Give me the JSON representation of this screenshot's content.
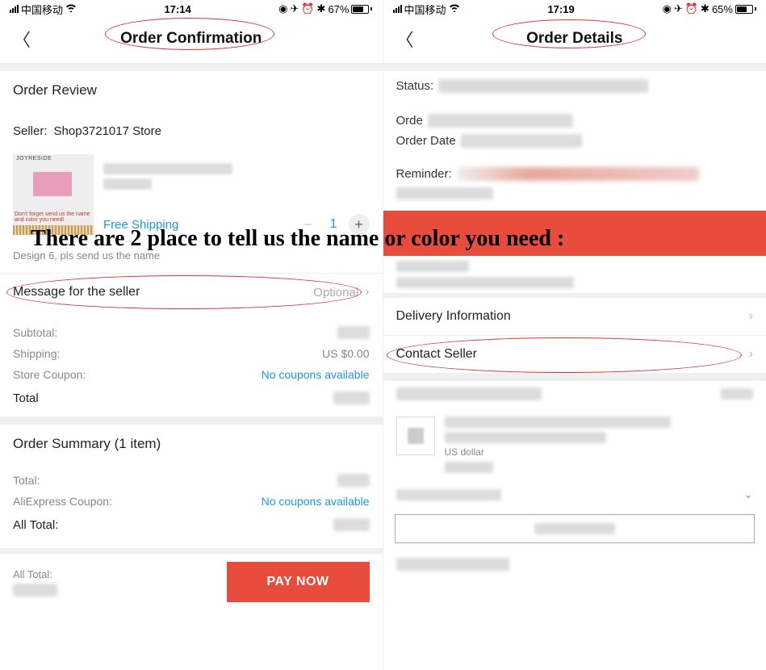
{
  "overlay_text": "There are 2 place to tell us the name or color you need :",
  "left": {
    "status": {
      "carrier": "中国移动",
      "time": "17:14",
      "battery_pct": "67%"
    },
    "nav_title": "Order Confirmation",
    "order_review_title": "Order Review",
    "seller_label": "Seller:",
    "seller_name": "Shop3721017 Store",
    "thumb_brand": "JOYRESIDE",
    "thumb_note": "Don't forget send us the name and color you need!",
    "shipping": "Free Shipping",
    "quantity": "1",
    "variant_note": "Design 6, pls send us the name",
    "message_label": "Message for the seller",
    "message_placeholder": "Optional",
    "subtotal_label": "Subtotal:",
    "shipping_label": "Shipping:",
    "shipping_value": "US $0.00",
    "coupon_label": "Store Coupon:",
    "coupon_value": "No coupons available",
    "total_label": "Total",
    "summary_title": "Order Summary (1 item)",
    "summary_total_label": "Total:",
    "ali_coupon_label": "AliExpress Coupon:",
    "ali_coupon_value": "No coupons available",
    "all_total_label": "All Total:",
    "footer_all_total": "All Total:",
    "pay_button": "PAY NOW"
  },
  "right": {
    "status": {
      "carrier": "中国移动",
      "time": "17:19",
      "battery_pct": "65%"
    },
    "nav_title": "Order Details",
    "status_label": "Status:",
    "order_label": "Orde",
    "order_date_label": "Order Date",
    "reminder_label": "Reminder:",
    "delivery_label": "Delivery Information",
    "contact_label": "Contact Seller",
    "currency_note": "US dollar"
  }
}
